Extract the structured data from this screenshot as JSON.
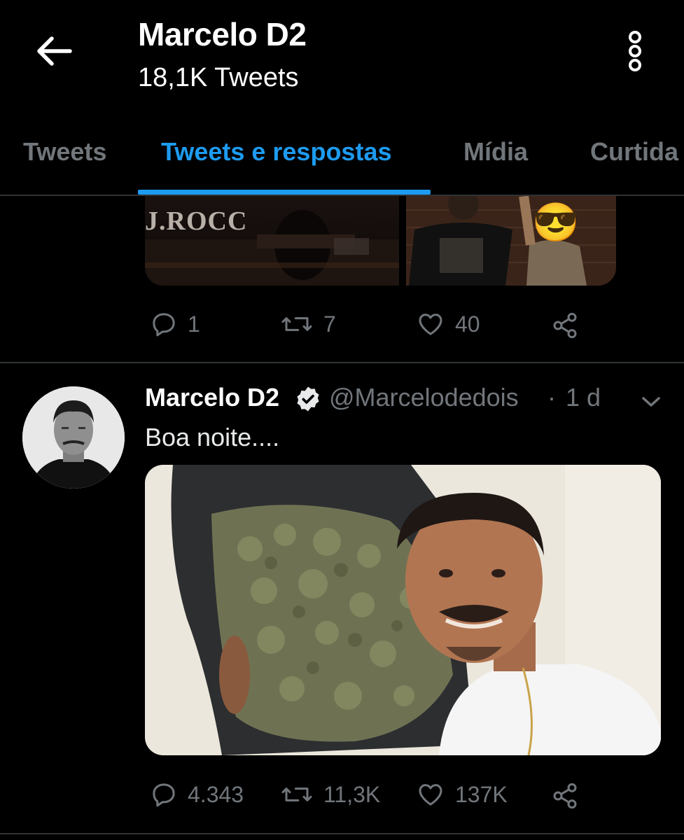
{
  "header": {
    "title": "Marcelo D2",
    "subtitle": "18,1K Tweets",
    "back_icon": "arrow-left-icon",
    "more_icon": "more-vertical-icon"
  },
  "tabs": [
    {
      "label": "Tweets"
    },
    {
      "label": "Tweets e respostas",
      "active": true
    },
    {
      "label": "Mídia"
    },
    {
      "label": "Curtida"
    }
  ],
  "previous_tweet": {
    "media_text": "J.ROCC",
    "emoji": "😎",
    "actions": {
      "replies": "1",
      "retweets": "7",
      "likes": "40"
    }
  },
  "tweet": {
    "name": "Marcelo D2",
    "handle": "@Marcelodedois",
    "separator": "·",
    "time": "1 d",
    "text": "Boa noite....",
    "actions": {
      "replies": "4.343",
      "retweets": "11,3K",
      "likes": "137K"
    }
  },
  "colors": {
    "background": "#000000",
    "accent": "#1d9bf0",
    "muted": "#71767b",
    "divider": "#2f3336"
  }
}
